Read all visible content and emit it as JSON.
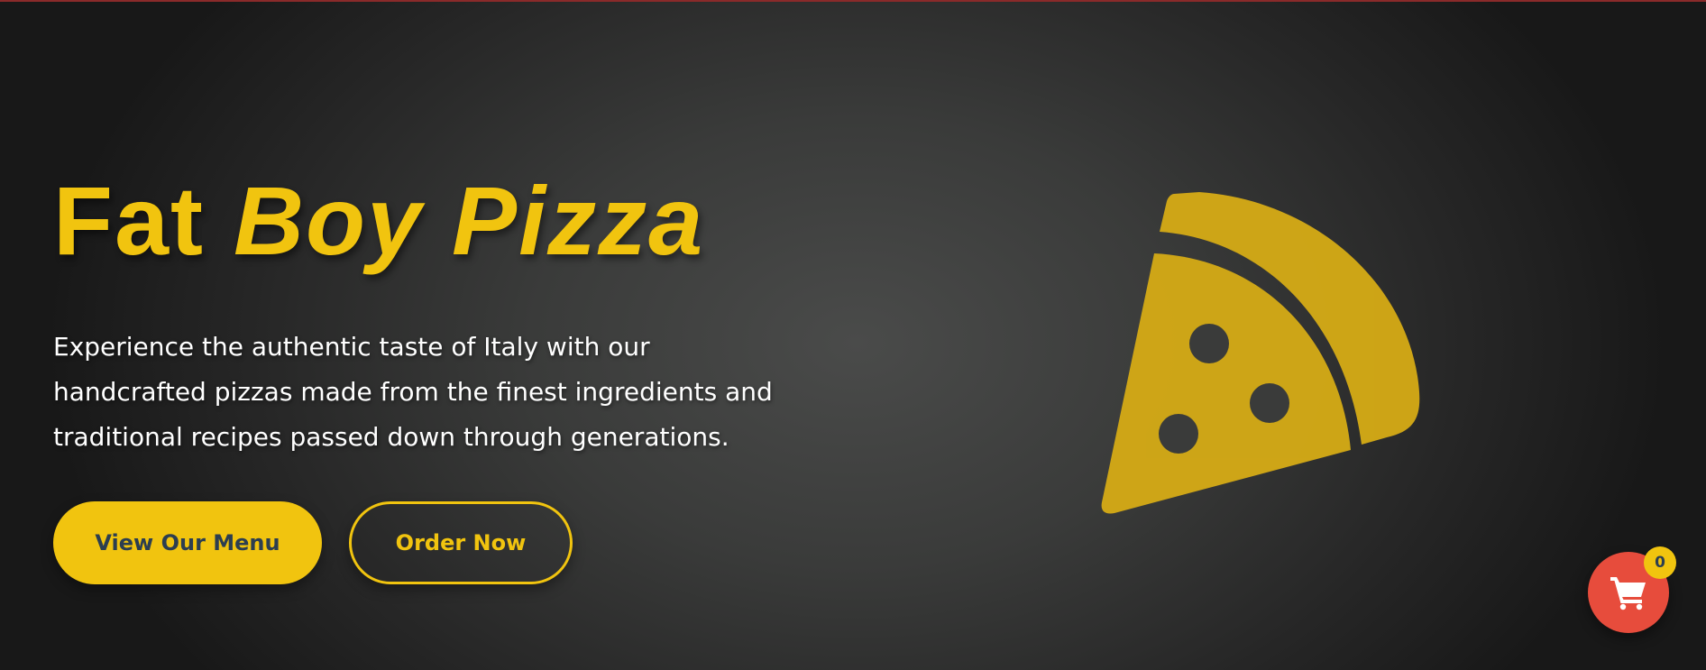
{
  "hero": {
    "title_plain": "Fat ",
    "title_accent": "Boy Pizza",
    "description": "Experience the authentic taste of Italy with our handcrafted pizzas made from the finest ingredients and traditional recipes passed down through generations.",
    "primary_button": "View Our Menu",
    "secondary_button": "Order Now"
  },
  "illustration": {
    "icon": "pizza-slice-icon"
  },
  "cart": {
    "icon": "shopping-cart-icon",
    "count": "0"
  },
  "colors": {
    "accent": "#f1c40f",
    "cart": "#e74c3c",
    "dark_text": "#2c3e50"
  }
}
